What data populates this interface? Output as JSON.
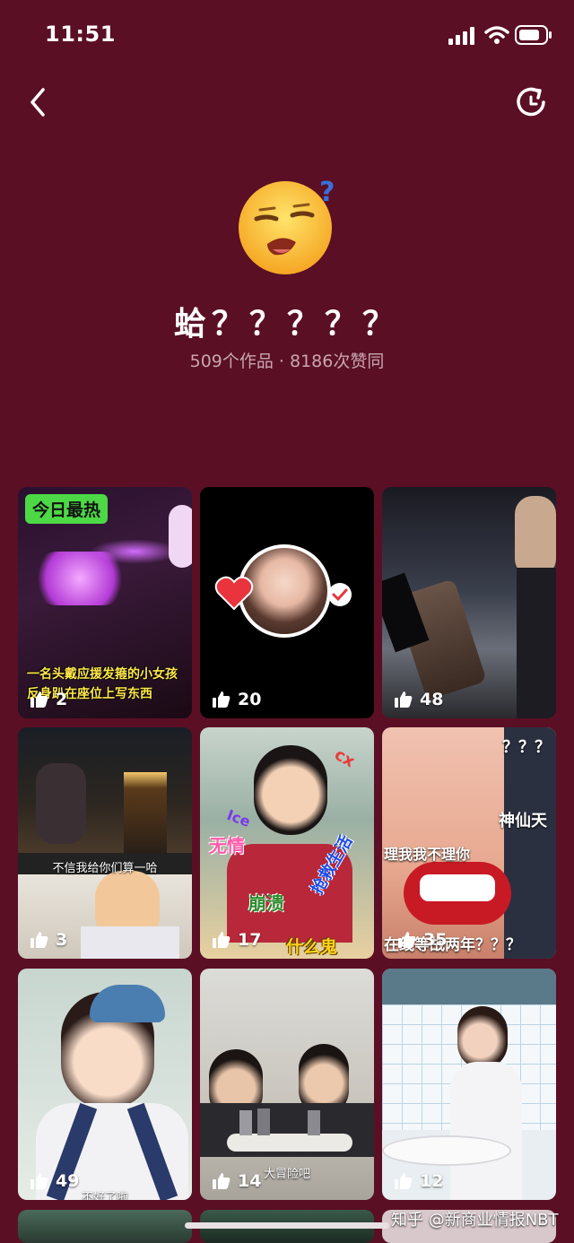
{
  "status": {
    "time": "11:51"
  },
  "profile": {
    "title": "蛤？？？？？",
    "subtitle": "509个作品 · 8186次赞同"
  },
  "tiles": [
    {
      "badge": "今日最热",
      "caption": "一名头戴应援发箍的小女孩\n反身趴在座位上写东西",
      "likes": "2"
    },
    {
      "likes": "20"
    },
    {
      "likes": "48"
    },
    {
      "caption": "不信我给你们算一哈",
      "likes": "3"
    },
    {
      "words": [
        "无情",
        "崩溃",
        "抢救生活",
        "什么鬼",
        "cx",
        "Ice"
      ],
      "likes": "17"
    },
    {
      "top_text": "？？？",
      "side_text": "神仙天",
      "mid_text": "理我我不理你",
      "bottom_text": "在线等战两年？？？",
      "likes": "35"
    },
    {
      "caption": "不好了啦",
      "likes": "49"
    },
    {
      "caption": "大冒险吧",
      "likes": "14"
    },
    {
      "likes": "12"
    }
  ],
  "watermark": "知乎 @新商业情报NBT",
  "icons": [
    "back-arrow-icon",
    "refresh-icon",
    "signal-icon",
    "wifi-icon",
    "battery-icon",
    "sleepy-emoji-icon",
    "thumbs-up-icon",
    "heart-icon",
    "check-icon"
  ]
}
